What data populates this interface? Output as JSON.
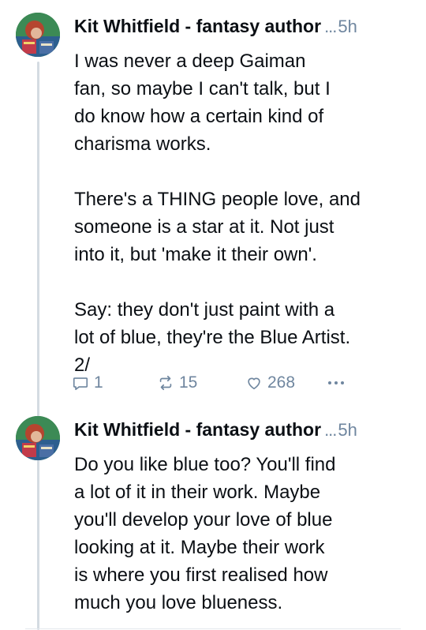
{
  "posts": [
    {
      "author": "Kit Whitfield - fantasy author",
      "ellipsis": "...",
      "time": "5h",
      "text": "I was never a deep Gaiman\nfan, so maybe I can't talk, but I\ndo know how a certain kind of\ncharisma works.\n\nThere's a THING people love, and\nsomeone is a star at it. Not just\ninto it, but 'make it their own'.\n\nSay: they don't just paint with a\nlot of blue, they're the Blue Artist.\n2/",
      "reply_count": "1",
      "repost_count": "15",
      "like_count": "268"
    },
    {
      "author": "Kit Whitfield - fantasy author",
      "ellipsis": "...",
      "time": "5h",
      "text": "Do you like blue too? You'll find\na lot of it in their work. Maybe\nyou'll develop your love of blue\nlooking at it. Maybe their work\nis where you first realised how\nmuch you love blueness."
    }
  ],
  "icons": {
    "reply": "reply-icon",
    "repost": "repost-icon",
    "like": "heart-icon",
    "more": "more-icon"
  },
  "colors": {
    "text": "#0b0f14",
    "muted": "#6f869f",
    "thread_line": "#d4dbe2"
  }
}
